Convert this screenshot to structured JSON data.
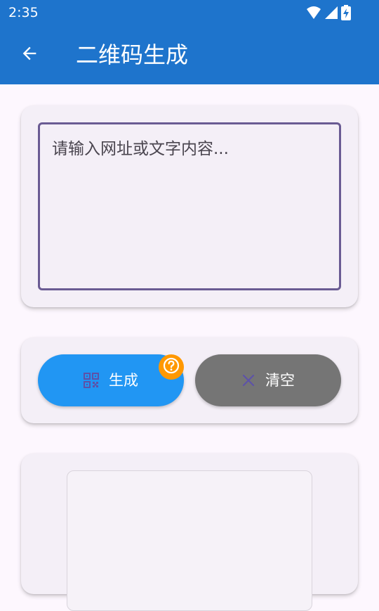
{
  "status_bar": {
    "time": "2:35",
    "icons": [
      "wifi-icon",
      "cellular-signal-icon",
      "battery-charging-icon"
    ]
  },
  "app_bar": {
    "title": "二维码生成",
    "back_icon": "arrow-back-icon"
  },
  "input": {
    "placeholder": "请输入网址或文字内容...",
    "value": ""
  },
  "buttons": {
    "generate_label": "生成",
    "generate_icon": "qr-code-icon",
    "clear_label": "清空",
    "clear_icon": "close-icon",
    "help_icon": "help-circle-icon"
  },
  "colors": {
    "app_bar": "#1e74cc",
    "generate_button": "#2196f3",
    "clear_button": "#757575",
    "help_badge": "#ff9800",
    "input_border": "#6a5b93",
    "card_background": "#f4eff7",
    "page_background": "#fdf7fe"
  }
}
